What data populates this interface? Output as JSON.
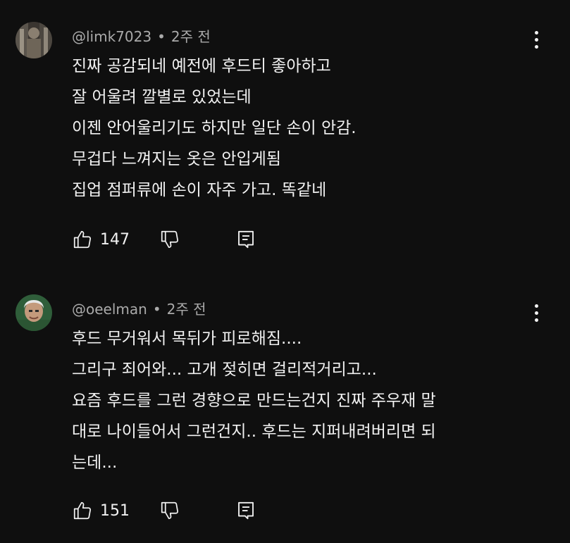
{
  "comments": [
    {
      "handle": "@limk7023",
      "separator": "•",
      "time": "2주 전",
      "lines": [
        "진짜 공감되네 예전에 후드티 좋아하고",
        "잘 어울려 깔별로 있었는데",
        "이젠 안어울리기도 하지만 일단 손이 안감.",
        "무겁다 느껴지는 옷은 안입게됨",
        "집업 점퍼류에 손이 자주 가고.  똑같네"
      ],
      "likes": "147",
      "icons": {
        "like": "thumb-up-icon",
        "dislike": "thumb-down-icon",
        "reply": "reply-icon",
        "menu": "more-vert-icon"
      }
    },
    {
      "handle": "@oeelman",
      "separator": "•",
      "time": "2주 전",
      "lines": [
        "후드 무거워서 목뒤가 피로해짐....",
        "그리구 죄어와... 고개 젖히면 걸리적거리고...",
        "요즘 후드를 그런 경향으로 만드는건지 진짜 주우재 말",
        "대로 나이들어서 그런건지.. 후드는 지퍼내려버리면 되",
        "는데..."
      ],
      "likes": "151",
      "icons": {
        "like": "thumb-up-icon",
        "dislike": "thumb-down-icon",
        "reply": "reply-icon",
        "menu": "more-vert-icon"
      }
    }
  ],
  "colors": {
    "background": "#0f0f0f",
    "text": "#f1f1f1",
    "meta": "#aaaaaa"
  }
}
